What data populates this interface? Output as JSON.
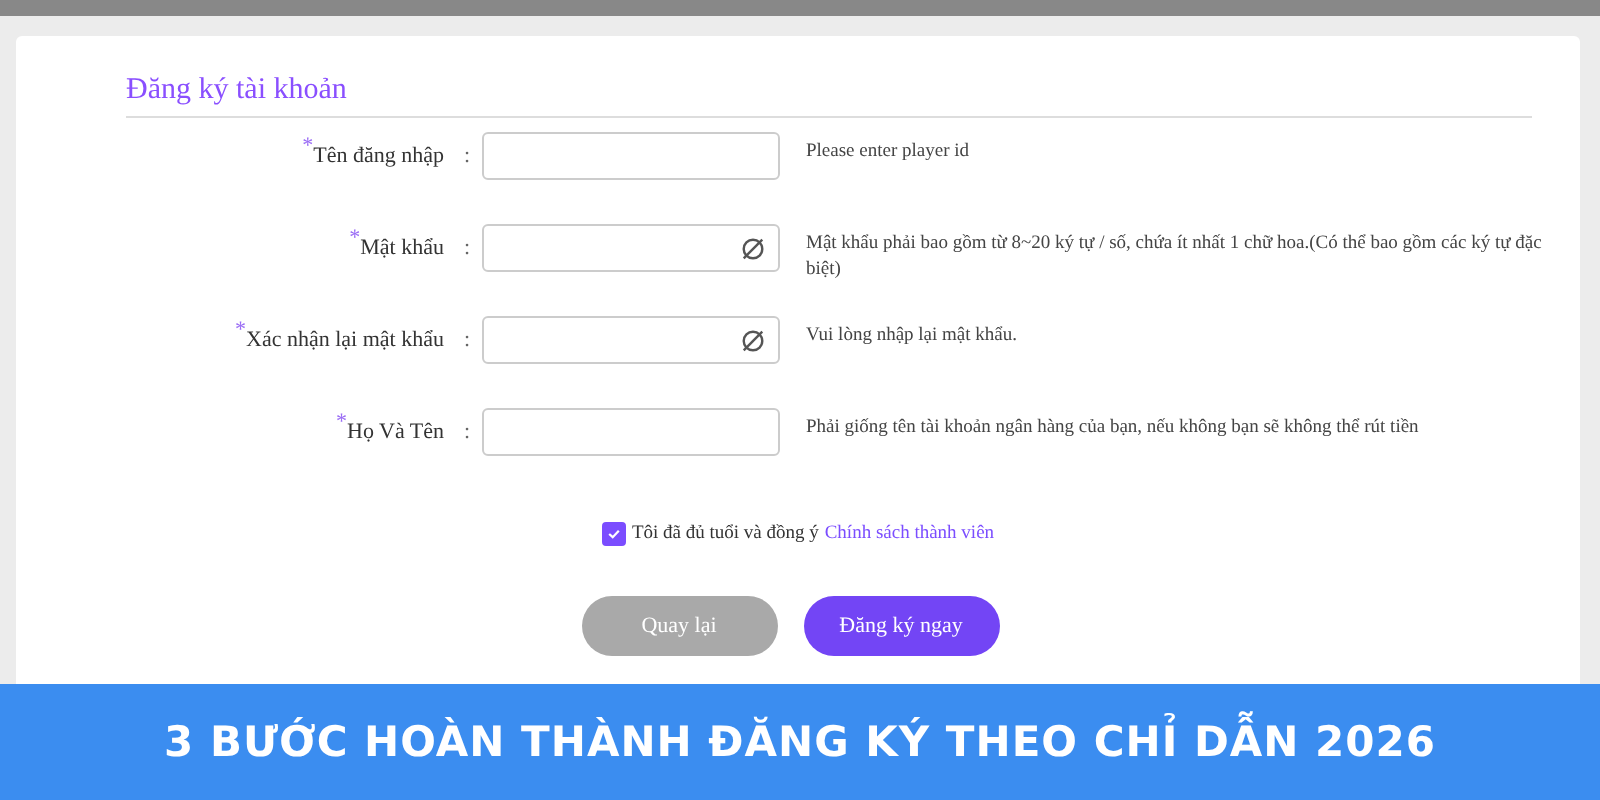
{
  "form": {
    "title": "Đăng ký tài khoản",
    "fields": [
      {
        "label": "Tên đăng nhập",
        "required": true,
        "kind": "text",
        "hint": "Please enter player id"
      },
      {
        "label": "Mật khẩu",
        "required": true,
        "kind": "password",
        "hint": "Mật khẩu phải bao gồm từ 8~20 ký tự / số, chứa ít nhất 1 chữ hoa.(Có thể bao gồm các ký tự đặc biệt)"
      },
      {
        "label": "Xác nhận lại mật khẩu",
        "required": true,
        "kind": "password",
        "hint": "Vui lòng nhập lại mật khẩu."
      },
      {
        "label": "Họ Và Tên",
        "required": true,
        "kind": "text",
        "hint": "Phải giống tên tài khoản ngân hàng của bạn, nếu không bạn sẽ không thể rút tiền"
      }
    ],
    "separator": ":",
    "required_mark": "*",
    "agree": {
      "checked": true,
      "text": "Tôi đã đủ tuổi và đồng ý",
      "link": "Chính sách thành viên"
    },
    "buttons": [
      {
        "label": "Quay lại",
        "kind": "secondary"
      },
      {
        "label": "Đăng ký ngay",
        "kind": "primary"
      }
    ]
  },
  "banner": {
    "text": "3 BƯỚC HOÀN THÀNH ĐĂNG KÝ THEO CHỈ DẪN 2026"
  }
}
